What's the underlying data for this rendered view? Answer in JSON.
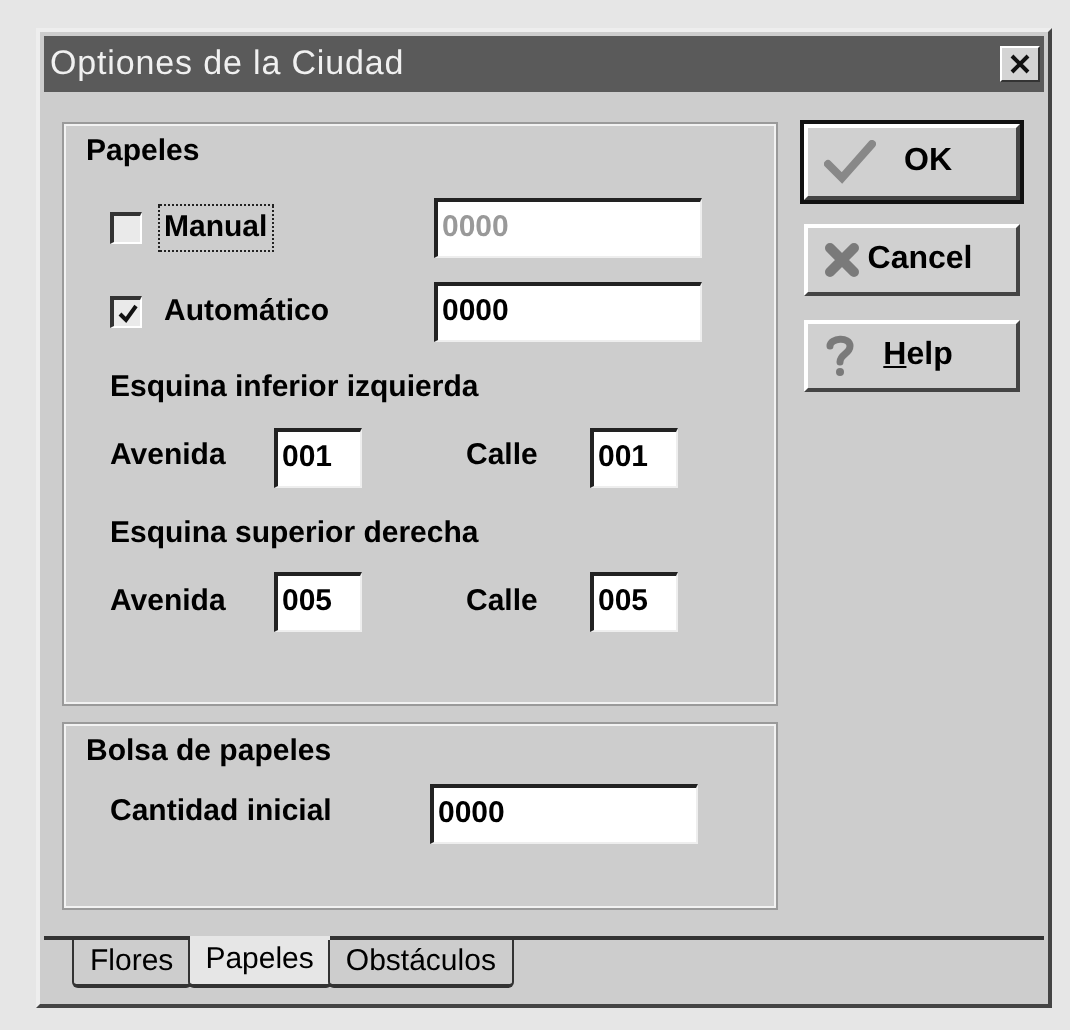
{
  "window": {
    "title": "Optiones de la Ciudad"
  },
  "papeles": {
    "title": "Papeles",
    "options": [
      {
        "label": "Manual",
        "checked": false,
        "focused": true,
        "value": "0000",
        "disabled": true
      },
      {
        "label": "Automático",
        "checked": true,
        "focused": false,
        "value": "0000",
        "disabled": false
      }
    ],
    "corners": [
      {
        "heading": "Esquina inferior izquierda",
        "fields": [
          {
            "label": "Avenida",
            "value": "001"
          },
          {
            "label": "Calle",
            "value": "001"
          }
        ]
      },
      {
        "heading": "Esquina superior derecha",
        "fields": [
          {
            "label": "Avenida",
            "value": "005"
          },
          {
            "label": "Calle",
            "value": "005"
          }
        ]
      }
    ]
  },
  "bolsa": {
    "title": "Bolsa de papeles",
    "fields": [
      {
        "label": "Cantidad inicial",
        "value": "0000"
      }
    ]
  },
  "buttons": [
    {
      "kind": "ok",
      "label": "OK",
      "default": true,
      "underline_first": false
    },
    {
      "kind": "cancel",
      "label": "Cancel",
      "default": false,
      "underline_first": false
    },
    {
      "kind": "help",
      "label": "Help",
      "default": false,
      "underline_first": true
    }
  ],
  "tabs": [
    {
      "label": "Flores",
      "selected": false
    },
    {
      "label": "Papeles",
      "selected": true
    },
    {
      "label": "Obstáculos",
      "selected": false
    }
  ]
}
